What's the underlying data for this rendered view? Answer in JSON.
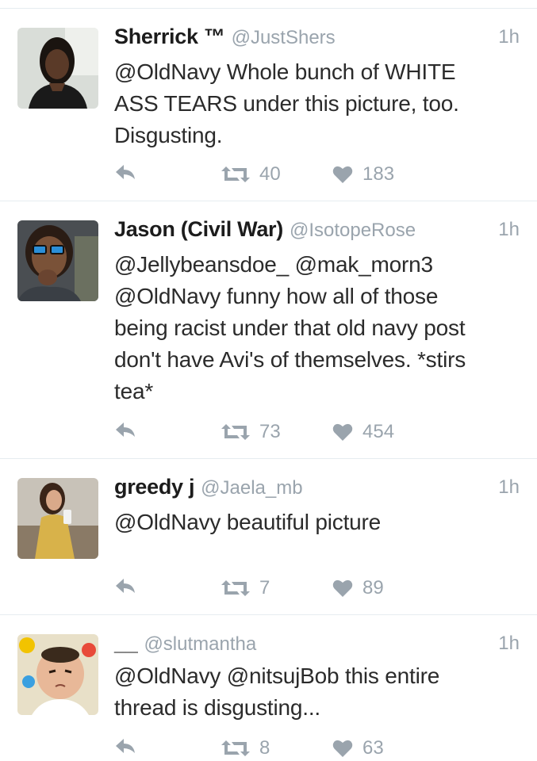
{
  "tweets": [
    {
      "name": "Sherrick ™",
      "handle": "@JustShers",
      "time": "1h",
      "lines": [
        "@OldNavy Whole bunch of WHITE",
        "ASS TEARS under this picture, too.",
        "Disgusting."
      ],
      "retweets": "40",
      "likes": "183",
      "icons": {
        "reply": "reply-icon",
        "retweet": "retweet-icon",
        "like": "heart-icon"
      }
    },
    {
      "name": "Jason (Civil War)",
      "handle": "@IsotopeRose",
      "time": "1h",
      "lines": [
        "@Jellybeansdoe_ @mak_morn3",
        "@OldNavy funny how all of those",
        "being racist under that old navy post",
        "don't have Avi's of themselves. *stirs",
        "tea*"
      ],
      "retweets": "73",
      "likes": "454",
      "icons": {
        "reply": "reply-icon",
        "retweet": "retweet-icon",
        "like": "heart-icon"
      }
    },
    {
      "name": "greedy j",
      "handle": "@Jaela_mb",
      "time": "1h",
      "lines": [
        "@OldNavy beautiful picture"
      ],
      "retweets": "7",
      "likes": "89",
      "icons": {
        "reply": "reply-icon",
        "retweet": "retweet-icon",
        "like": "heart-icon"
      }
    },
    {
      "name": "__",
      "handle": "@slutmantha",
      "time": "1h",
      "lines": [
        "@OldNavy @nitsujBob this entire",
        "thread is disgusting..."
      ],
      "retweets": "8",
      "likes": "63",
      "icons": {
        "reply": "reply-icon",
        "retweet": "retweet-icon",
        "like": "heart-icon"
      }
    }
  ],
  "colors": {
    "muted": "#9aa4ad",
    "text": "#2b2b2b",
    "divider": "#e6ecf0"
  }
}
